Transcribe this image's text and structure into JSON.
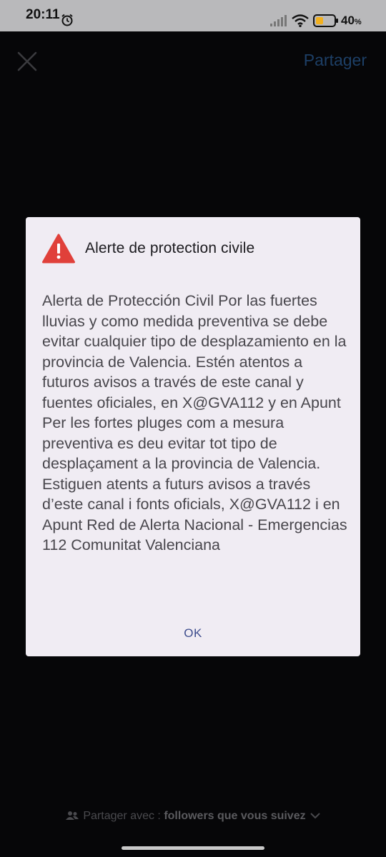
{
  "status_bar": {
    "time": "20:11",
    "battery_percent": "40",
    "battery_unit": "%"
  },
  "top_bar": {
    "share_label": "Partager"
  },
  "alert": {
    "title": "Alerte de protection civile",
    "body": "Alerta de Protección Civil Por las fuertes lluvias y como medida preventiva se debe evitar cualquier tipo de desplazamiento en la provincia de Valencia. Estén atentos a futuros avisos a través de este canal y fuentes oficiales, en X@GVA112 y en Apunt Per les fortes pluges com a mesura preventiva es deu evitar tot tipo de desplaçament a la provincia de Valencia. Estiguen atents a futurs avisos a través d’este canal i fonts oficials, X@GVA112 i en Apunt Red de Alerta Nacional - Emergencias 112 Comunitat Valenciana",
    "ok_label": "OK"
  },
  "footer": {
    "share_prefix": "Partager avec : ",
    "audience": "followers que vous suivez"
  },
  "colors": {
    "dialog_background": "#f0ecf3",
    "warning_red": "#e0403a",
    "accent_blue": "#3f4e8e",
    "share_blue": "#1d3f66"
  },
  "icons": [
    "alarm-icon",
    "signal-icon",
    "wifi-icon",
    "battery-icon",
    "close-icon",
    "warning-icon",
    "people-icon",
    "chevron-down-icon"
  ]
}
